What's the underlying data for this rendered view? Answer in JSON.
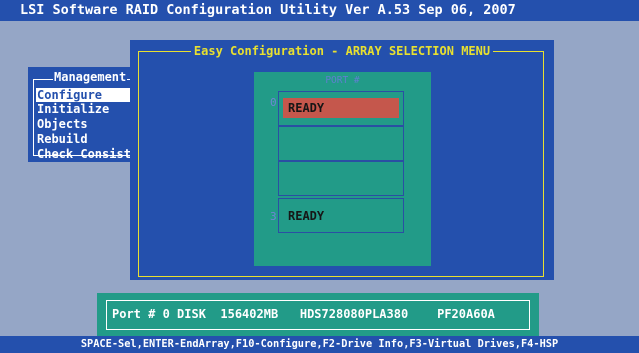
{
  "title": "LSI Software RAID Configuration Utility Ver A.53 Sep 06, 2007",
  "management": {
    "title": "Management",
    "items": [
      "Configure",
      "Initialize",
      "Objects",
      "Rebuild",
      "Check Consist"
    ],
    "selected_index": 0
  },
  "easy_config": {
    "title": "Easy Configuration - ARRAY SELECTION MENU"
  },
  "port_panel": {
    "header": "PORT #",
    "slots": [
      {
        "number": "0",
        "status": "READY",
        "selected": true
      },
      {
        "number": "",
        "status": "",
        "selected": false
      },
      {
        "number": "",
        "status": "",
        "selected": false
      },
      {
        "number": "3",
        "status": "READY",
        "selected": false
      }
    ]
  },
  "disk_info": {
    "text": "Port # 0 DISK  156402MB   HDS728080PLA380    PF20A60A"
  },
  "status_bar": {
    "text": "SPACE-Sel,ENTER-EndArray,F10-Configure,F2-Drive Info,F3-Virtual Drives,F4-HSP"
  },
  "colors": {
    "background": "#95a6c6",
    "panel_blue": "#2450ad",
    "teal": "#229b88",
    "frame_yellow": "#e8e030",
    "selection_red": "#c5574c"
  }
}
